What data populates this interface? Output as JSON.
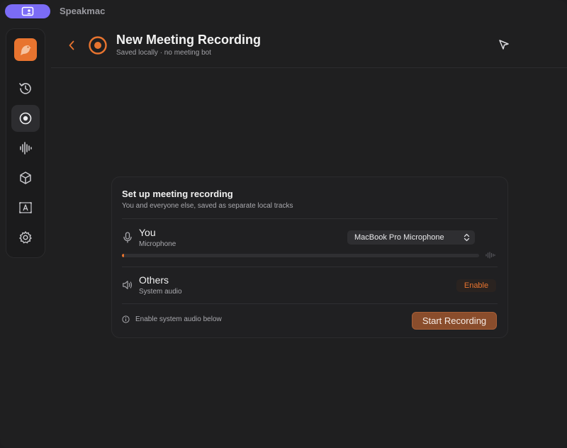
{
  "app": {
    "name": "Speakmac",
    "pill_icon": "window-person-icon",
    "accent": "#e8742f",
    "pill_color": "#7b6cf6"
  },
  "sidebar": {
    "items": [
      {
        "name": "history",
        "icon": "history-icon",
        "active": false
      },
      {
        "name": "record",
        "icon": "record-icon",
        "active": true
      },
      {
        "name": "waveform",
        "icon": "waveform-icon",
        "active": false
      },
      {
        "name": "models",
        "icon": "cube-icon",
        "active": false
      },
      {
        "name": "text",
        "icon": "text-box-icon",
        "active": false
      },
      {
        "name": "settings",
        "icon": "gear-icon",
        "active": false
      }
    ]
  },
  "header": {
    "title": "New Meeting Recording",
    "subtitle": "Saved locally · no meeting bot"
  },
  "card": {
    "title": "Set up meeting recording",
    "subtitle": "You and everyone else, saved as separate local tracks",
    "you": {
      "title": "You",
      "subtitle": "Microphone",
      "device": "MacBook Pro Microphone",
      "level": 0.005
    },
    "others": {
      "title": "Others",
      "subtitle": "System audio",
      "action": "Enable"
    },
    "info": "Enable system audio below",
    "start_label": "Start Recording"
  }
}
